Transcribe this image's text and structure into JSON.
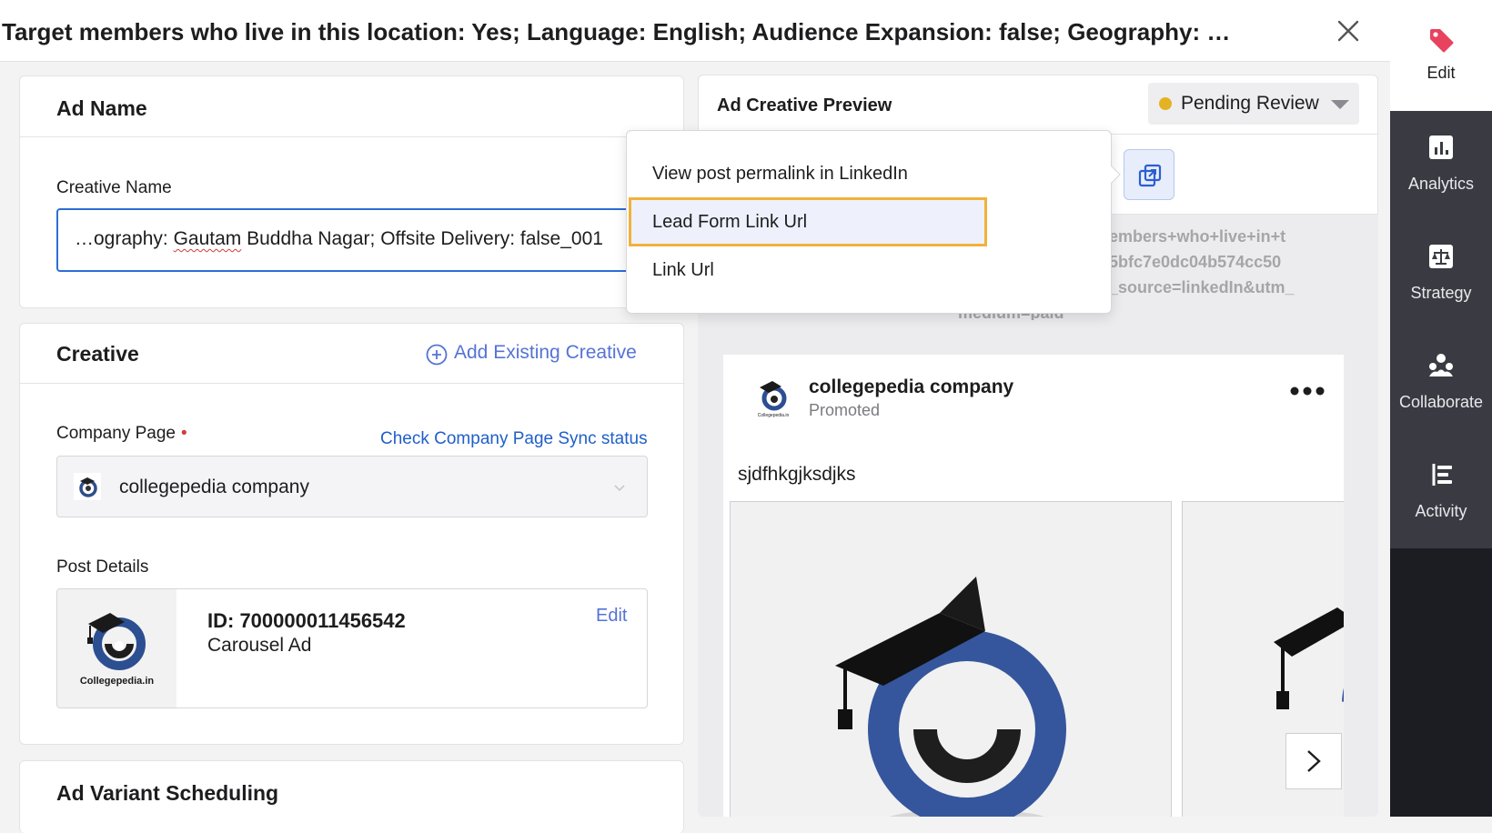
{
  "header": {
    "title": "Target members who live in this location: Yes; Language: English; Audience Expansion: false; Geography: Ga..."
  },
  "rail": {
    "items": [
      {
        "label": "Edit",
        "icon": "tag-icon"
      },
      {
        "label": "Analytics",
        "icon": "bar-chart-icon"
      },
      {
        "label": "Strategy",
        "icon": "scale-icon"
      },
      {
        "label": "Collaborate",
        "icon": "people-icon"
      },
      {
        "label": "Activity",
        "icon": "timeline-icon"
      }
    ]
  },
  "ad_name": {
    "title": "Ad Name",
    "creative_name_label": "Creative Name",
    "creative_name_value_pre": "…ography: ",
    "creative_name_value_squiggle": "Gautam",
    "creative_name_value_post": " Buddha Nagar; Offsite Delivery: false_001"
  },
  "creative": {
    "title": "Creative",
    "add_existing_label": "Add Existing Creative",
    "company_page_label": "Company Page",
    "check_sync_label": "Check Company Page Sync status",
    "company_page_value": "collegepedia company",
    "post_details_label": "Post Details",
    "post_id": "ID: 700000011456542",
    "post_type": "Carousel Ad",
    "edit_label": "Edit",
    "thumb_caption": "Collegepedia.in"
  },
  "scheduling": {
    "title": "Ad Variant Scheduling"
  },
  "preview": {
    "title": "Ad Creative Preview",
    "status_label": "Pending Review",
    "status_color": "#e3b325",
    "url_lines": [
      "embers+who+live+in+t",
      "5bfc7e0dc04b574cc50",
      "_source=linkedIn&utm_",
      "medium=paid"
    ],
    "company_name": "collegepedia company",
    "promoted_label": "Promoted",
    "post_text": "sjdfhkgjksdjks",
    "logo_caption": "Collegepedia.in"
  },
  "menu": {
    "items": [
      "View post permalink in LinkedIn",
      "Lead Form Link Url",
      "Link Url"
    ],
    "highlighted_index": 1
  },
  "colors": {
    "accent_blue": "#2b6fd6",
    "link_blue": "#1f5fc9",
    "tag_pink": "#e8425f",
    "highlight_border": "#f2b13c"
  }
}
